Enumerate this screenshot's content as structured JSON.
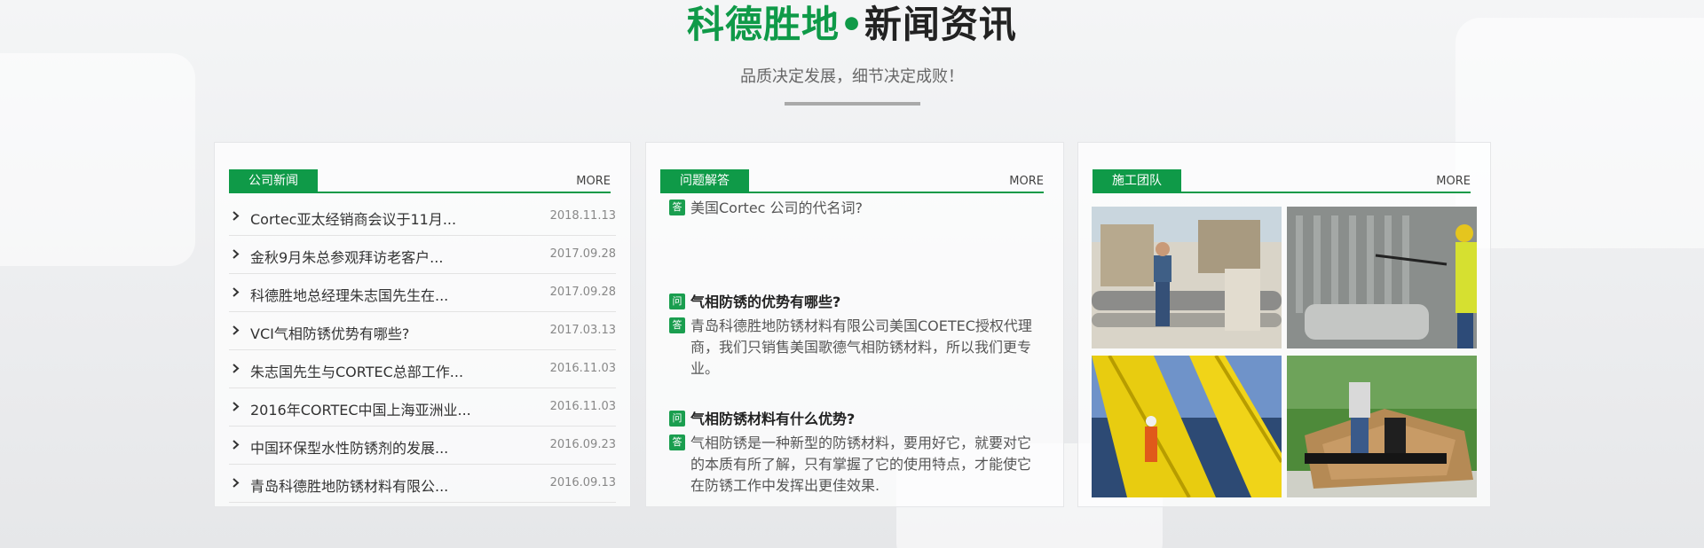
{
  "header": {
    "title_brand": "科德胜地",
    "title_dot": "•",
    "title_rest": "新闻资讯",
    "subtitle": "品质决定发展，细节决定成败！"
  },
  "colors": {
    "accent": "#0f9a48",
    "badge": "#1a9e4f"
  },
  "news_panel": {
    "tab": "公司新闻",
    "more": "MORE",
    "items": [
      {
        "title": "Cortec亚太经销商会议于11月...",
        "date": "2018.11.13"
      },
      {
        "title": "金秋9月朱总参观拜访老客户...",
        "date": "2017.09.28"
      },
      {
        "title": "科德胜地总经理朱志国先生在...",
        "date": "2017.09.28"
      },
      {
        "title": "VCI气相防锈优势有哪些?",
        "date": "2017.03.13"
      },
      {
        "title": "朱志国先生与CORTEC总部工作...",
        "date": "2016.11.03"
      },
      {
        "title": "2016年CORTEC中国上海亚洲业...",
        "date": "2016.11.03"
      },
      {
        "title": "中国环保型水性防锈剂的发展...",
        "date": "2016.09.23"
      },
      {
        "title": "青岛科德胜地防锈材料有限公...",
        "date": "2016.09.13"
      }
    ]
  },
  "qa_panel": {
    "tab": "问题解答",
    "more": "MORE",
    "q_badge": "问",
    "a_badge": "答",
    "first_answer": "美国Cortec 公司的代名词?",
    "items": [
      {
        "question": "气相防锈的优势有哪些?",
        "answer": "青岛科德胜地防锈材料有限公司美国COETEC授权代理商，我们只销售美国歌德气相防锈材料，所以我们更专业。"
      },
      {
        "question": "气相防锈材料有什么优势?",
        "answer": "气相防锈是一种新型的防锈材料，要用好它，就要对它的本质有所了解，只有掌握了它的使用特点，才能使它在防锈工作中发挥出更佳效果."
      }
    ]
  },
  "team_panel": {
    "tab": "施工团队",
    "more": "MORE",
    "photos": [
      "pipe-inspection-photo",
      "pressure-washing-photo",
      "offshore-rig-photo",
      "tarp-covering-photo"
    ]
  }
}
